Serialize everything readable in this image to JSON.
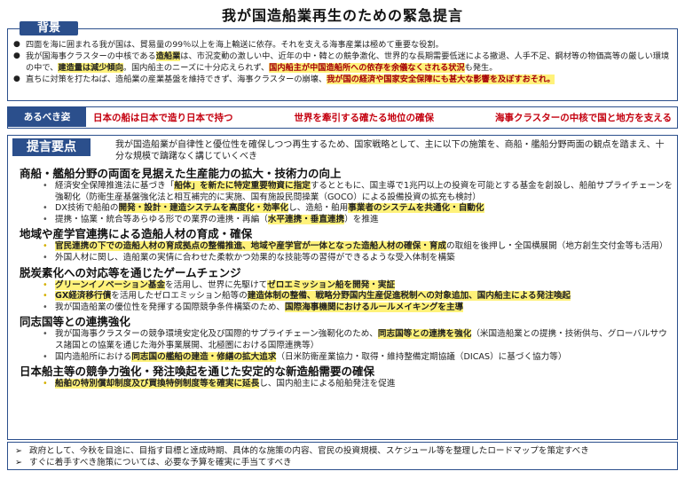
{
  "title": "我が国造船業再生のための緊急提言",
  "background": {
    "label": "背景",
    "items": [
      [
        {
          "t": "四面を海に囲まれる我が国は、貿易量の99％以上を海上輸送に依存。それを支える海事産業は極めて重要な役割。"
        }
      ],
      [
        {
          "t": "我が国海事クラスターの中核である"
        },
        {
          "t": "造船業",
          "s": "hl"
        },
        {
          "t": "は、市況変動の激しい中、近年の中・韓との競争激化、世界的な長期需要低迷による撤退、人手不足、鋼材等の物価高等の厳しい環境の中で、"
        },
        {
          "t": "建造量は減少傾向",
          "s": "hl"
        },
        {
          "t": "。国内船主のニーズに十分応えられず、"
        },
        {
          "t": "国内船主が中国造船所への依存を余儀なくされる状況",
          "s": "hlr"
        },
        {
          "t": "も発生。"
        }
      ],
      [
        {
          "t": "直ちに対策を打たねば、造船業の産業基盤を維持できず、海事クラスターの崩壊、"
        },
        {
          "t": "我が国の経済や国家安全保障にも甚大な影響を及ぼすおそれ。",
          "s": "hlr"
        }
      ]
    ]
  },
  "aspiration": {
    "label": "あるべき姿",
    "items": [
      "日本の船は日本で造り日本で持つ",
      "世界を牽引する確たる地位の確保",
      "海事クラスターの中核で国と地方を支える"
    ]
  },
  "proposals": {
    "label": "提言要点",
    "intro": "我が国造船業が自律性と優位性を確保しつつ再生するため、国家戦略として、主に以下の施策を、商船・艦船分野両面の観点を踏まえ、十分な規模で躊躇なく講じていくべき",
    "sections": [
      {
        "heading": "商船・艦船分野の両面を見据えた生産能力の拡大・技術力の向上",
        "bullets": [
          [
            {
              "t": "経済安全保障推進法に基づき「"
            },
            {
              "t": "船体」を新たに特定重要物資に指定",
              "s": "hl"
            },
            {
              "t": "するとともに、国主導で1兆円以上の投資を可能とする基金を創設し、船舶サプライチェーンを強靭化（防衛生産基盤強化法と相互補完的に実施、国有施設民間操業（GOCO）による設備投資の拡充も検討）"
            }
          ],
          [
            {
              "t": "DX技術で船舶の"
            },
            {
              "t": "開発・設計・建造システムを高度化・効率化",
              "s": "hl"
            },
            {
              "t": "し、造船・舶用"
            },
            {
              "t": "事業者のシステムを共通化・自動化",
              "s": "hl"
            }
          ],
          [
            {
              "t": "提携・協業・統合等あらゆる形での業界の連携・再編（"
            },
            {
              "t": "水平連携・垂直連携",
              "s": "hl"
            },
            {
              "t": "）を推進"
            }
          ]
        ]
      },
      {
        "heading": "地域や産学官連携による造船人材の育成・確保",
        "bullets": [
          [
            {
              "t": "官民連携の下での造船人材の育成拠点の整備推進、地域や産学官が一体となった造船人材の確保・育成",
              "s": "hl"
            },
            {
              "t": "の取組を後押し・全国横展開（地方創生交付金等も活用）"
            }
          ],
          [
            {
              "t": "外国人材に関し、造船業の実情に合わせた柔軟かつ効果的な技能等の習得ができるような受入体制を構築"
            }
          ]
        ]
      },
      {
        "heading": "脱炭素化への対応等を通じたゲームチェンジ",
        "bullets": [
          [
            {
              "t": "グリーンイノベーション基金",
              "s": "hl"
            },
            {
              "t": "を活用し、世界に先駆けて"
            },
            {
              "t": "ゼロエミッション船を開発・実証",
              "s": "hl"
            }
          ],
          [
            {
              "t": "GX経済移行債",
              "s": "hl"
            },
            {
              "t": "を活用したゼロエミッション船等の"
            },
            {
              "t": "建造体制の整備、戦略分野国内生産促進税制への対象追加、国内船主による発注喚起",
              "s": "hl"
            }
          ],
          [
            {
              "t": "我が国造船業の優位性を発揮する国際競争条件構築のため、"
            },
            {
              "t": "国際海事機関におけるルールメイキングを主導",
              "s": "hl"
            }
          ]
        ]
      },
      {
        "heading": "同志国等との連携強化",
        "bullets": [
          [
            {
              "t": "我が国海事クラスターの競争環境安定化及び国際的サプライチェーン強靭化のため、"
            },
            {
              "t": "同志国等との連携を強化",
              "s": "hl"
            },
            {
              "t": "（米国造船業との提携・技術供与、グローバルサウス諸国との協業を通じた海外事業展開、北極圏における国際連携等）"
            }
          ],
          [
            {
              "t": "国内造船所における"
            },
            {
              "t": "同志国の艦船の建造・修繕の拡大追求",
              "s": "hl"
            },
            {
              "t": "（日米防衛産業協力・取得・維持整備定期協議（DICAS）に基づく協力等）"
            }
          ]
        ]
      },
      {
        "heading": "日本船主等の競争力強化・発注喚起を通じた安定的な新造船需要の確保",
        "bullets": [
          [
            {
              "t": "船舶の特別償却制度及び買換特例制度等を確実に延長",
              "s": "hl"
            },
            {
              "t": "し、国内船主による船舶発注を促進"
            }
          ]
        ]
      }
    ]
  },
  "footer": [
    "政府として、今秋を目途に、目指す目標と達成時期、具体的な施策の内容、官民の投資規模、スケジュール等を整理したロードマップを策定すべき",
    "すぐに着手すべき施策については、必要な予算を確実に手当てすべき"
  ],
  "colors": {
    "accent": "#2b4f8c",
    "highlight": "#fff27a",
    "red": "#c4000f"
  }
}
